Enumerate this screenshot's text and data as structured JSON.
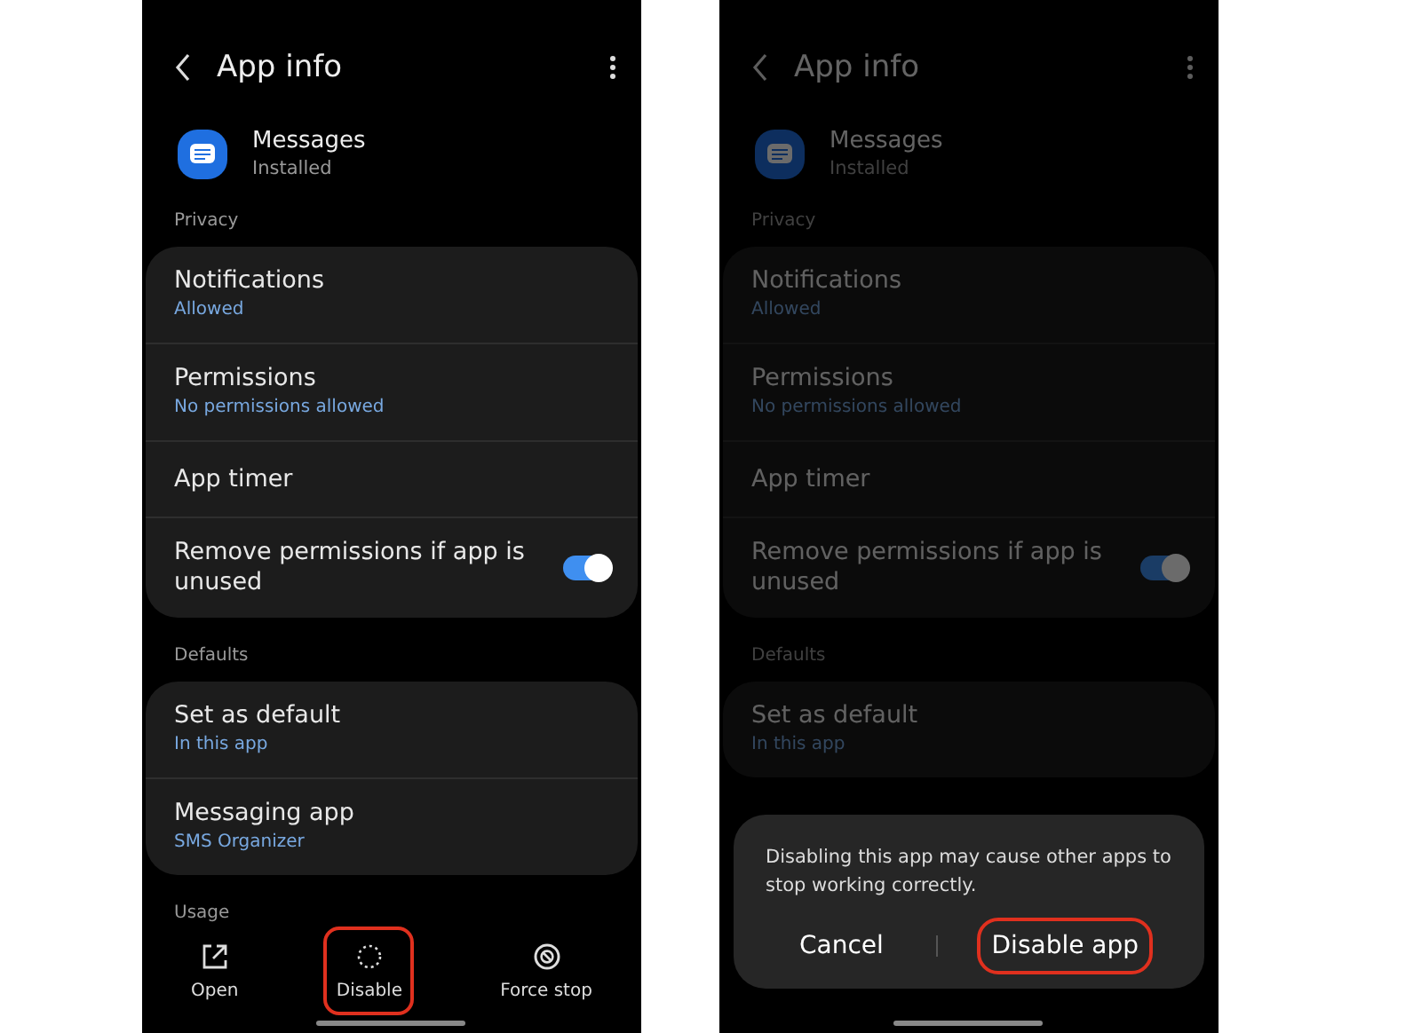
{
  "screens": [
    {
      "dimmed": false,
      "title": "App info",
      "app": {
        "name": "Messages",
        "status": "Installed"
      },
      "sections": [
        {
          "label": "Privacy",
          "items": [
            {
              "kind": "link",
              "title": "Notifications",
              "subtitle": "Allowed"
            },
            {
              "kind": "link",
              "title": "Permissions",
              "subtitle": "No permissions allowed"
            },
            {
              "kind": "link",
              "title": "App timer"
            },
            {
              "kind": "toggle",
              "title": "Remove permissions if app is unused",
              "on": true
            }
          ]
        },
        {
          "label": "Defaults",
          "items": [
            {
              "kind": "link",
              "title": "Set as default",
              "subtitle": "In this app"
            },
            {
              "kind": "link",
              "title": "Messaging app",
              "subtitle": "SMS Organizer"
            }
          ]
        },
        {
          "label": "Usage"
        }
      ],
      "actions": [
        {
          "kind": "open",
          "label": "Open",
          "highlighted": false
        },
        {
          "kind": "disable",
          "label": "Disable",
          "highlighted": true
        },
        {
          "kind": "stop",
          "label": "Force stop",
          "highlighted": false
        }
      ]
    },
    {
      "dimmed": true,
      "title": "App info",
      "app": {
        "name": "Messages",
        "status": "Installed"
      },
      "sections": [
        {
          "label": "Privacy",
          "items": [
            {
              "kind": "link",
              "title": "Notifications",
              "subtitle": "Allowed"
            },
            {
              "kind": "link",
              "title": "Permissions",
              "subtitle": "No permissions allowed"
            },
            {
              "kind": "link",
              "title": "App timer"
            },
            {
              "kind": "toggle",
              "title": "Remove permissions if app is unused",
              "on": true
            }
          ]
        },
        {
          "label": "Defaults",
          "items": [
            {
              "kind": "link",
              "title": "Set as default",
              "subtitle": "In this app"
            }
          ]
        }
      ],
      "dialog": {
        "message": "Disabling this app may cause other apps to stop working correctly.",
        "buttons": [
          {
            "label": "Cancel",
            "highlighted": false
          },
          {
            "label": "Disable app",
            "highlighted": true
          }
        ]
      }
    }
  ]
}
